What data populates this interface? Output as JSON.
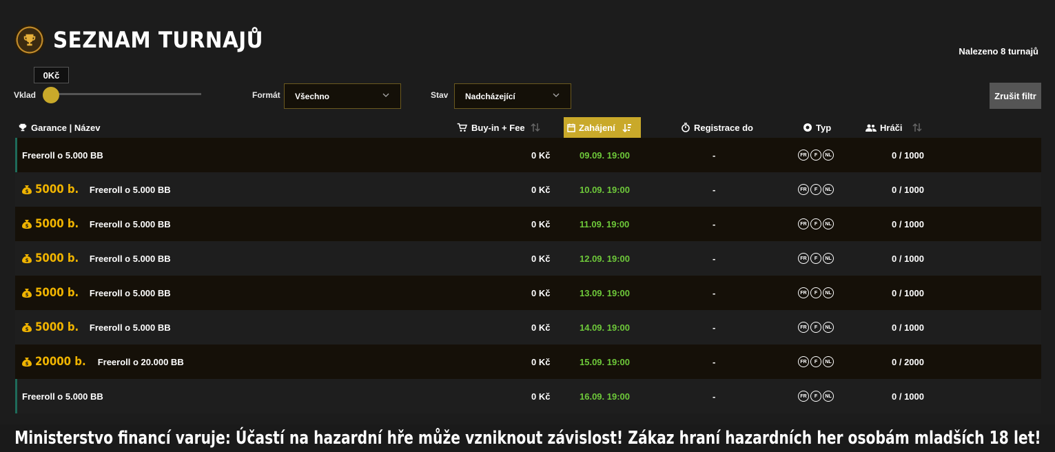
{
  "header": {
    "title": "SEZNAM TURNAJŮ",
    "found_count": "Nalezeno 8 turnajů"
  },
  "filters": {
    "deposit_label": "Vklad",
    "deposit_value": "0Kč",
    "deposit_level": 0,
    "format_label": "Formát",
    "format_value": "Všechno",
    "status_label": "Stav",
    "status_value": "Nadcházející",
    "reset_label": "Zrušit filtr"
  },
  "columns": {
    "name": "Garance | Název",
    "buyin": "Buy-in + Fee",
    "start": "Zahájení",
    "registration": "Registrace do",
    "type": "Typ",
    "players": "Hráči"
  },
  "type_icons": [
    "FR",
    "F",
    "NL"
  ],
  "rows": [
    {
      "guarantee": "",
      "name": "Freeroll o 5.000 BB",
      "buyin": "0 Kč",
      "start": "09.09. 19:00",
      "registration": "-",
      "players": "0 / 1000"
    },
    {
      "guarantee": "5000 b.",
      "name": "Freeroll o 5.000 BB",
      "buyin": "0 Kč",
      "start": "10.09. 19:00",
      "registration": "-",
      "players": "0 / 1000"
    },
    {
      "guarantee": "5000 b.",
      "name": "Freeroll o 5.000 BB",
      "buyin": "0 Kč",
      "start": "11.09. 19:00",
      "registration": "-",
      "players": "0 / 1000"
    },
    {
      "guarantee": "5000 b.",
      "name": "Freeroll o 5.000 BB",
      "buyin": "0 Kč",
      "start": "12.09. 19:00",
      "registration": "-",
      "players": "0 / 1000"
    },
    {
      "guarantee": "5000 b.",
      "name": "Freeroll o 5.000 BB",
      "buyin": "0 Kč",
      "start": "13.09. 19:00",
      "registration": "-",
      "players": "0 / 1000"
    },
    {
      "guarantee": "5000 b.",
      "name": "Freeroll o 5.000 BB",
      "buyin": "0 Kč",
      "start": "14.09. 19:00",
      "registration": "-",
      "players": "0 / 1000"
    },
    {
      "guarantee": "20000 b.",
      "name": "Freeroll o 20.000 BB",
      "buyin": "0 Kč",
      "start": "15.09. 19:00",
      "registration": "-",
      "players": "0 / 2000"
    },
    {
      "guarantee": "",
      "name": "Freeroll o 5.000 BB",
      "buyin": "0 Kč",
      "start": "16.09. 19:00",
      "registration": "-",
      "players": "0 / 1000"
    }
  ],
  "warning": "Ministerstvo financí varuje: Účastí na hazardní hře může vzniknout závislost! Zákaz hraní hazardních her osobám mladších 18 let!",
  "colors": {
    "accent": "#c9a92a",
    "guarantee": "#f0b400",
    "start_time": "#6ec93a",
    "row_accent": "#1e6b5a"
  }
}
